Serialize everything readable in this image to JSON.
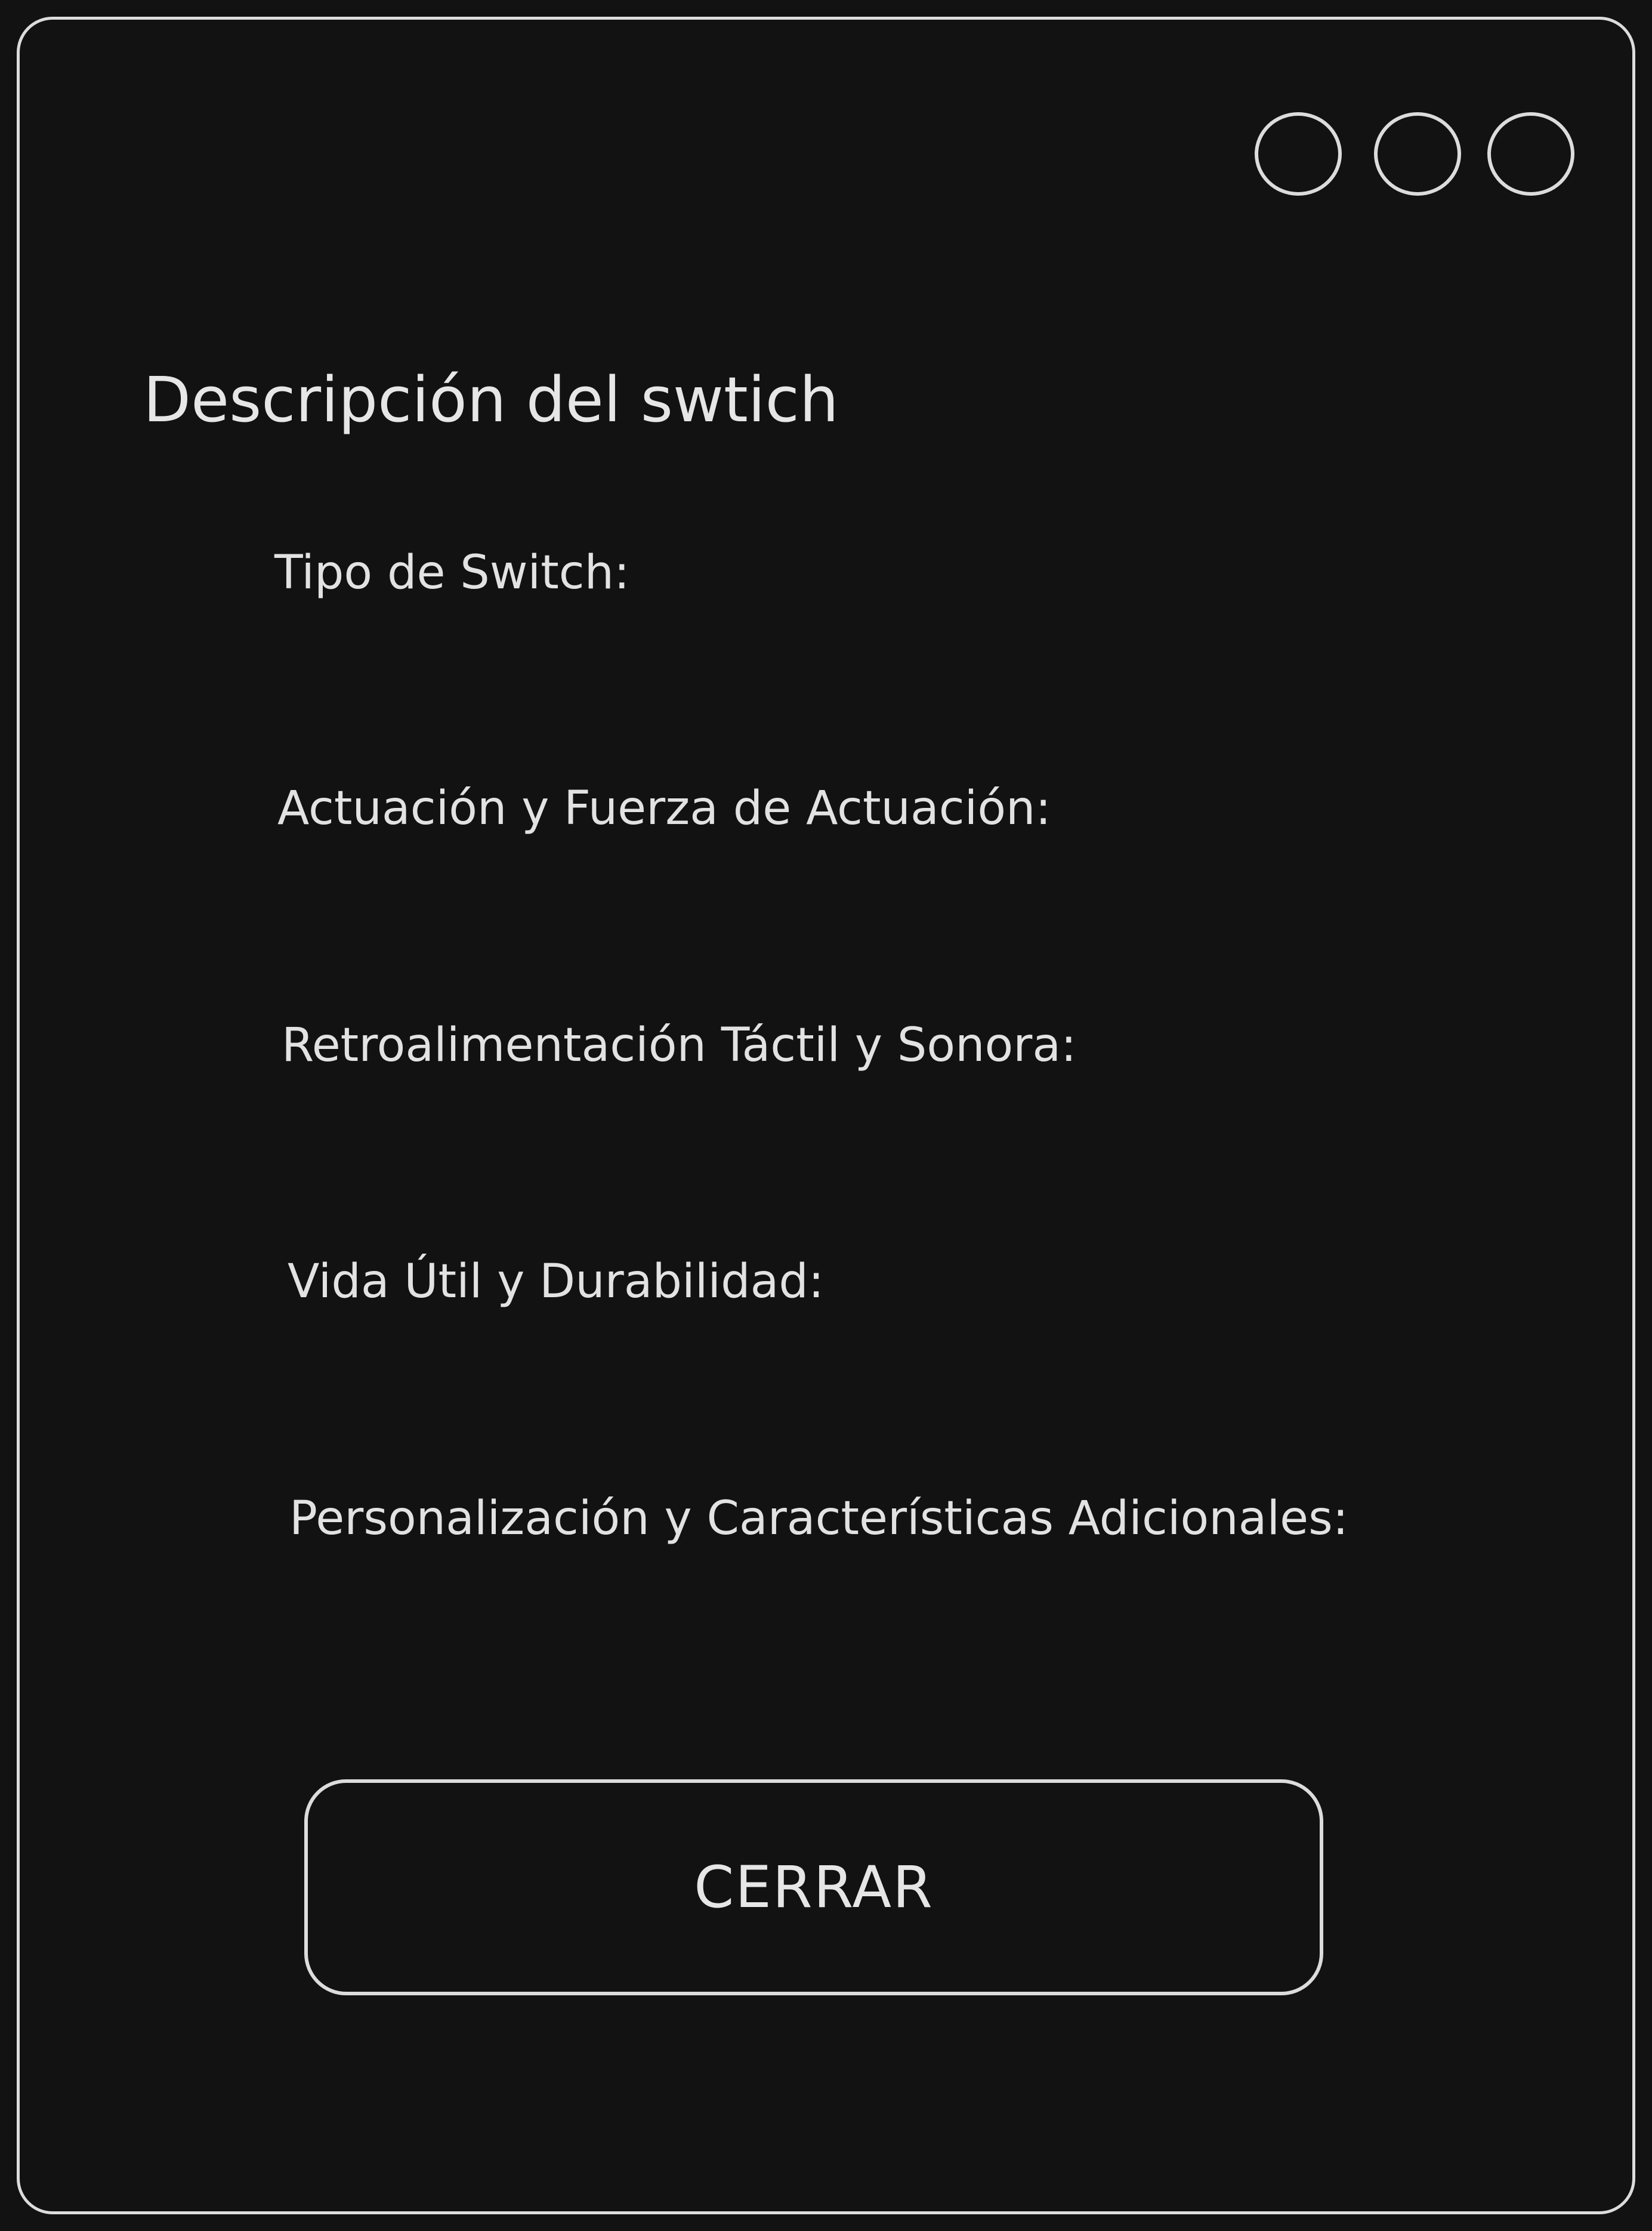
{
  "window": {
    "controls": [
      "circle-button",
      "circle-button",
      "circle-button"
    ]
  },
  "panel": {
    "title": "Descripción del swtich",
    "fields": [
      "Tipo de Switch:",
      "Actuación y Fuerza de Actuación:",
      "Retroalimentación Táctil y Sonora:",
      "Vida Útil y Durabilidad:",
      "Personalización y Características Adicionales:"
    ],
    "close_label": "CERRAR"
  },
  "colors": {
    "background": "#121212",
    "stroke": "#dcdcdc",
    "text": "#e4e4e4"
  }
}
